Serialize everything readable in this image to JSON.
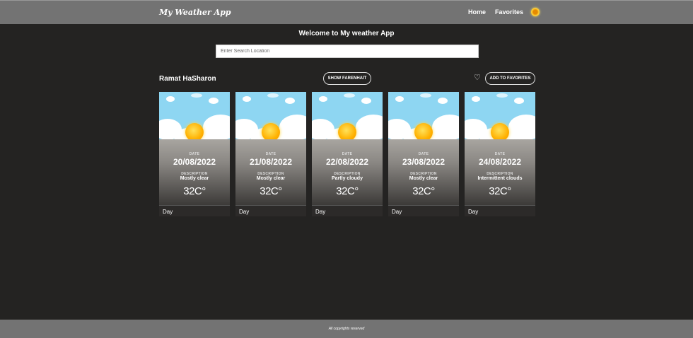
{
  "header": {
    "logo": "My Weather App",
    "nav": [
      "Home",
      "Favorites"
    ],
    "theme_icon": "sun-icon"
  },
  "main": {
    "welcome": "Welcome to My weather App",
    "search_placeholder": "Enter Search Location",
    "city": "Ramat HaSharon",
    "unit_button": "SHOW FARENHAIT",
    "favorite_button": "ADD TO FAVORITES",
    "date_label": "DATE",
    "description_label": "DESCRIPTION",
    "forecast": [
      {
        "date": "20/08/2022",
        "description": "Mostly clear",
        "temp": "32C°",
        "period": "Day"
      },
      {
        "date": "21/08/2022",
        "description": "Mostly clear",
        "temp": "32C°",
        "period": "Day"
      },
      {
        "date": "22/08/2022",
        "description": "Partly cloudy",
        "temp": "32C°",
        "period": "Day"
      },
      {
        "date": "23/08/2022",
        "description": "Mostly clear",
        "temp": "32C°",
        "period": "Day"
      },
      {
        "date": "24/08/2022",
        "description": "Intermittent clouds",
        "temp": "32C°",
        "period": "Day"
      }
    ]
  },
  "footer": {
    "text": "All copyrights reserved"
  }
}
